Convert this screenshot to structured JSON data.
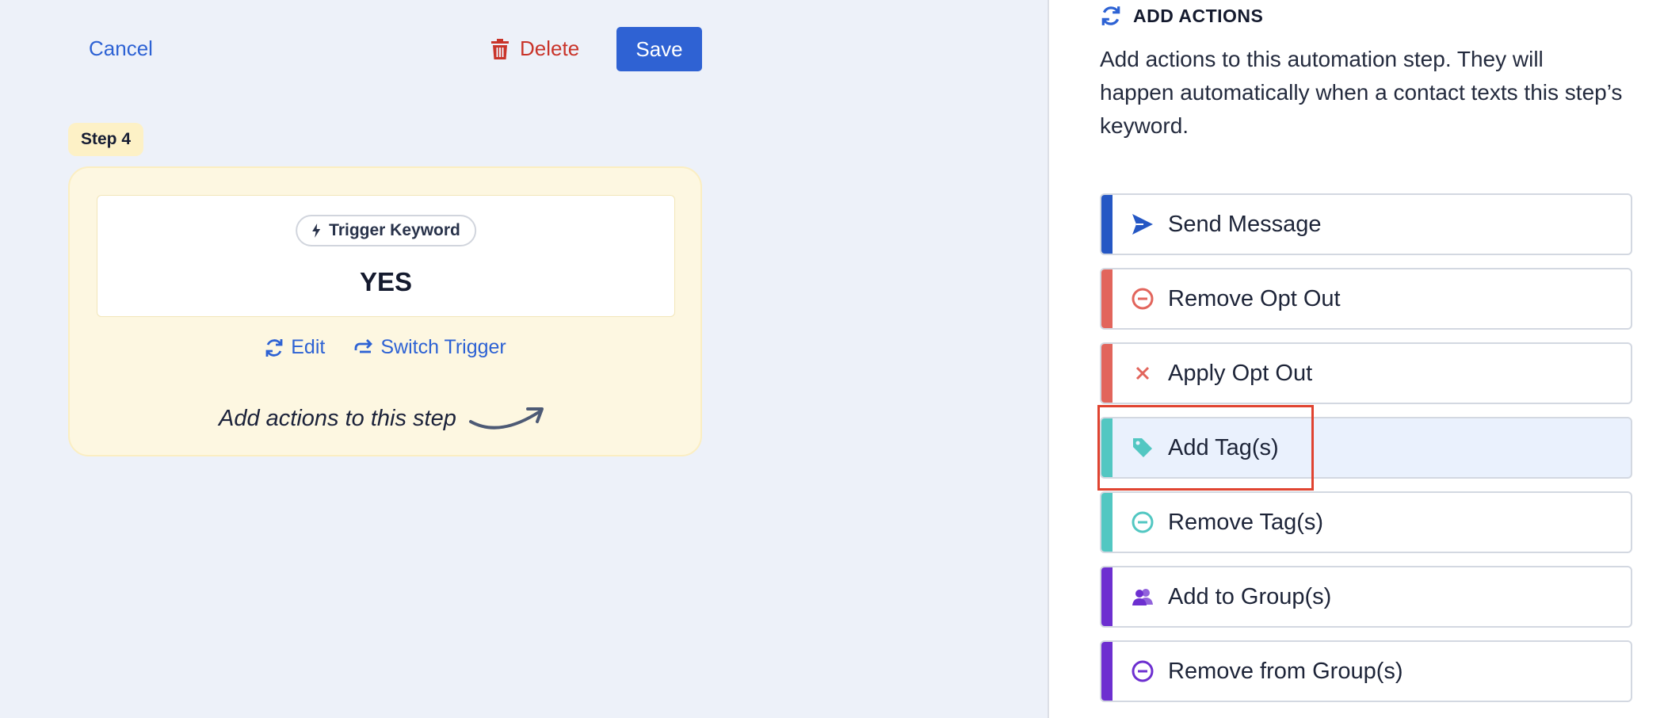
{
  "header": {
    "cancel_label": "Cancel",
    "delete_label": "Delete",
    "save_label": "Save"
  },
  "step": {
    "badge": "Step 4",
    "trigger_label": "Trigger Keyword",
    "trigger_value": "YES",
    "edit_label": "Edit",
    "switch_label": "Switch Trigger",
    "hint": "Add actions to this step"
  },
  "panel": {
    "title": "ADD ACTIONS",
    "description": "Add actions to this automation step. They will happen automatically when a contact texts this step’s keyword.",
    "actions": [
      {
        "label": "Send Message",
        "icon": "send-icon",
        "color": "#2557c4"
      },
      {
        "label": "Remove Opt Out",
        "icon": "minus-circle-icon",
        "color": "#e2655c"
      },
      {
        "label": "Apply Opt Out",
        "icon": "close-icon",
        "color": "#e2655c"
      },
      {
        "label": "Add Tag(s)",
        "icon": "tag-icon",
        "color": "#52c7c2",
        "selected": true
      },
      {
        "label": "Remove Tag(s)",
        "icon": "minus-circle-icon",
        "color": "#52c7c2"
      },
      {
        "label": "Add to Group(s)",
        "icon": "users-icon",
        "color": "#6d2fd0"
      },
      {
        "label": "Remove from Group(s)",
        "icon": "minus-circle-icon",
        "color": "#6d2fd0"
      }
    ]
  },
  "colors": {
    "primary": "#2f62d3",
    "danger": "#c9342a",
    "step_card_bg": "#fdf7e1",
    "highlight": "#e04330"
  }
}
